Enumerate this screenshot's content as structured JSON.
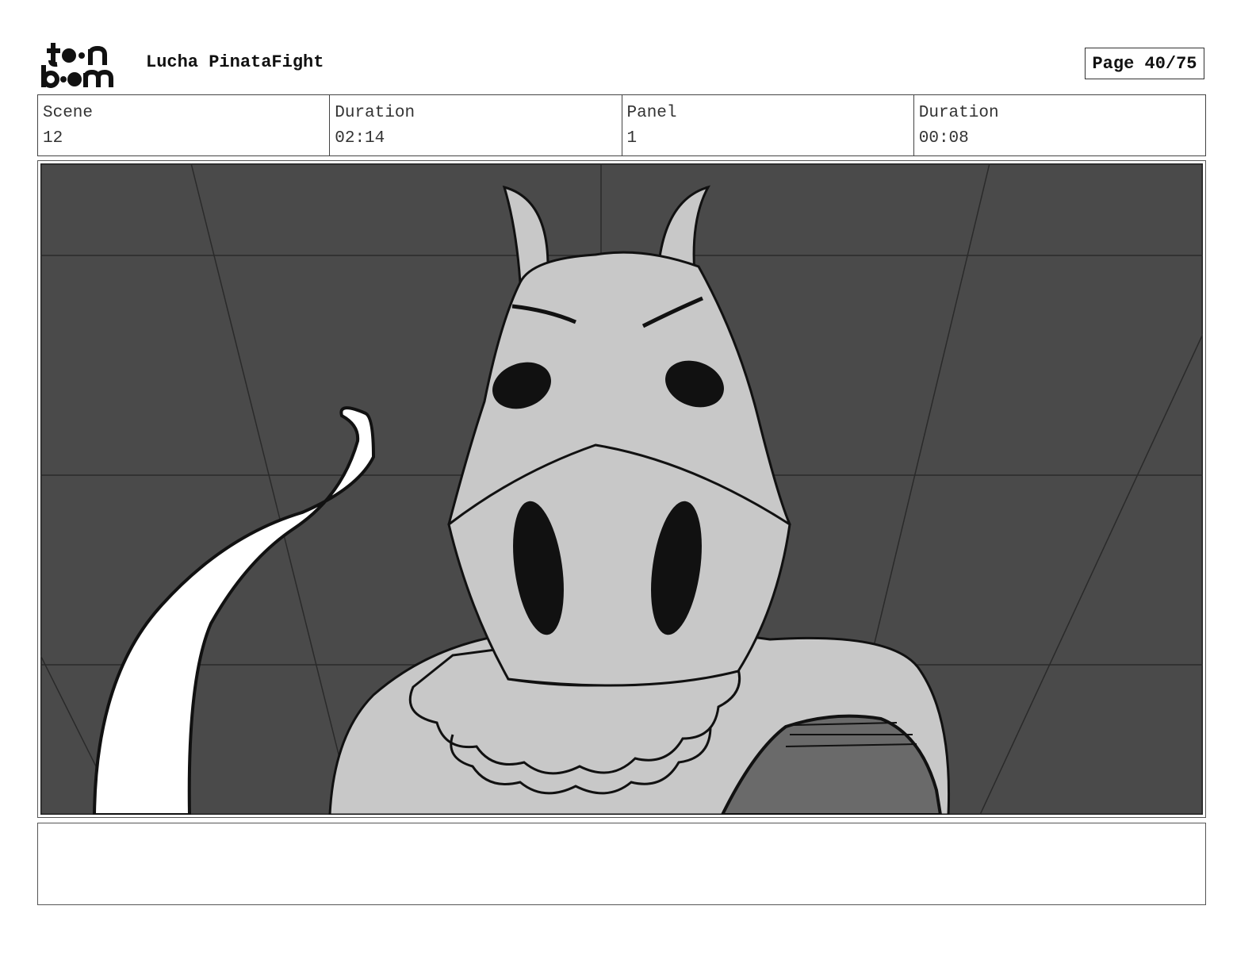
{
  "header": {
    "logo_text": "toon boom",
    "project_title": "Lucha PinataFight",
    "page_label": "Page 40/75"
  },
  "info": {
    "scene_label": "Scene",
    "scene_value": "12",
    "scene_duration_label": "Duration",
    "scene_duration_value": "02:14",
    "panel_label": "Panel",
    "panel_value": "1",
    "panel_duration_label": "Duration",
    "panel_duration_value": "00:08"
  },
  "panel": {
    "image_subject": "sketch of a horned pinata wrestler mask character in a boxing ring",
    "colors": {
      "background": "#4a4a4a",
      "character": "#c8c8c8",
      "tail": "#ffffff"
    }
  },
  "notes": {
    "text": ""
  }
}
